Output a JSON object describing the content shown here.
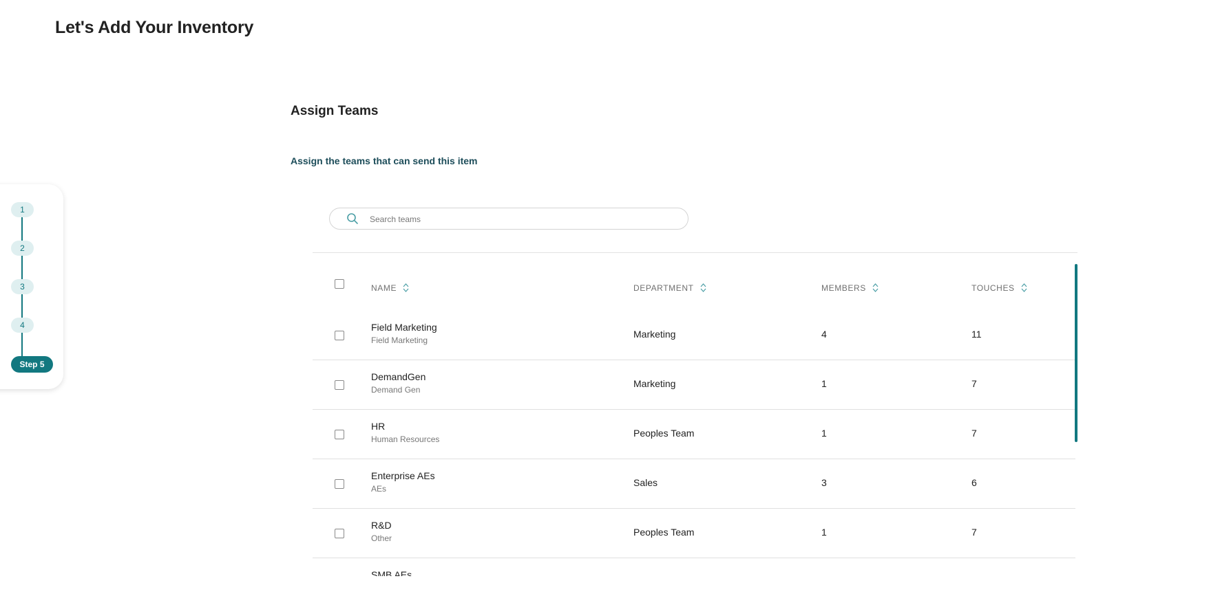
{
  "page": {
    "title": "Let's Add Your Inventory"
  },
  "stepper": {
    "steps": [
      "1",
      "2",
      "3",
      "4"
    ],
    "active_label": "Step 5"
  },
  "section": {
    "title": "Assign Teams",
    "subtitle": "Assign the teams that can send this item"
  },
  "search": {
    "placeholder": "Search teams",
    "value": ""
  },
  "table": {
    "columns": [
      "NAME",
      "DEPARTMENT",
      "MEMBERS",
      "TOUCHES"
    ],
    "rows": [
      {
        "name": "Field Marketing",
        "sub": "Field Marketing",
        "department": "Marketing",
        "members": "4",
        "touches": "11"
      },
      {
        "name": "DemandGen",
        "sub": "Demand Gen",
        "department": "Marketing",
        "members": "1",
        "touches": "7"
      },
      {
        "name": "HR",
        "sub": "Human Resources",
        "department": "Peoples Team",
        "members": "1",
        "touches": "7"
      },
      {
        "name": "Enterprise AEs",
        "sub": "AEs",
        "department": "Sales",
        "members": "3",
        "touches": "6"
      },
      {
        "name": "R&D",
        "sub": "Other",
        "department": "Peoples Team",
        "members": "1",
        "touches": "7"
      },
      {
        "name": "SMB AEs",
        "sub": "",
        "department": "",
        "members": "",
        "touches": ""
      }
    ]
  },
  "colors": {
    "accent": "#127880",
    "step_bg": "#dfeff0",
    "subtitle": "#1d4d5a"
  },
  "icons": {
    "search": "search-icon",
    "sort": "sort-icon"
  }
}
